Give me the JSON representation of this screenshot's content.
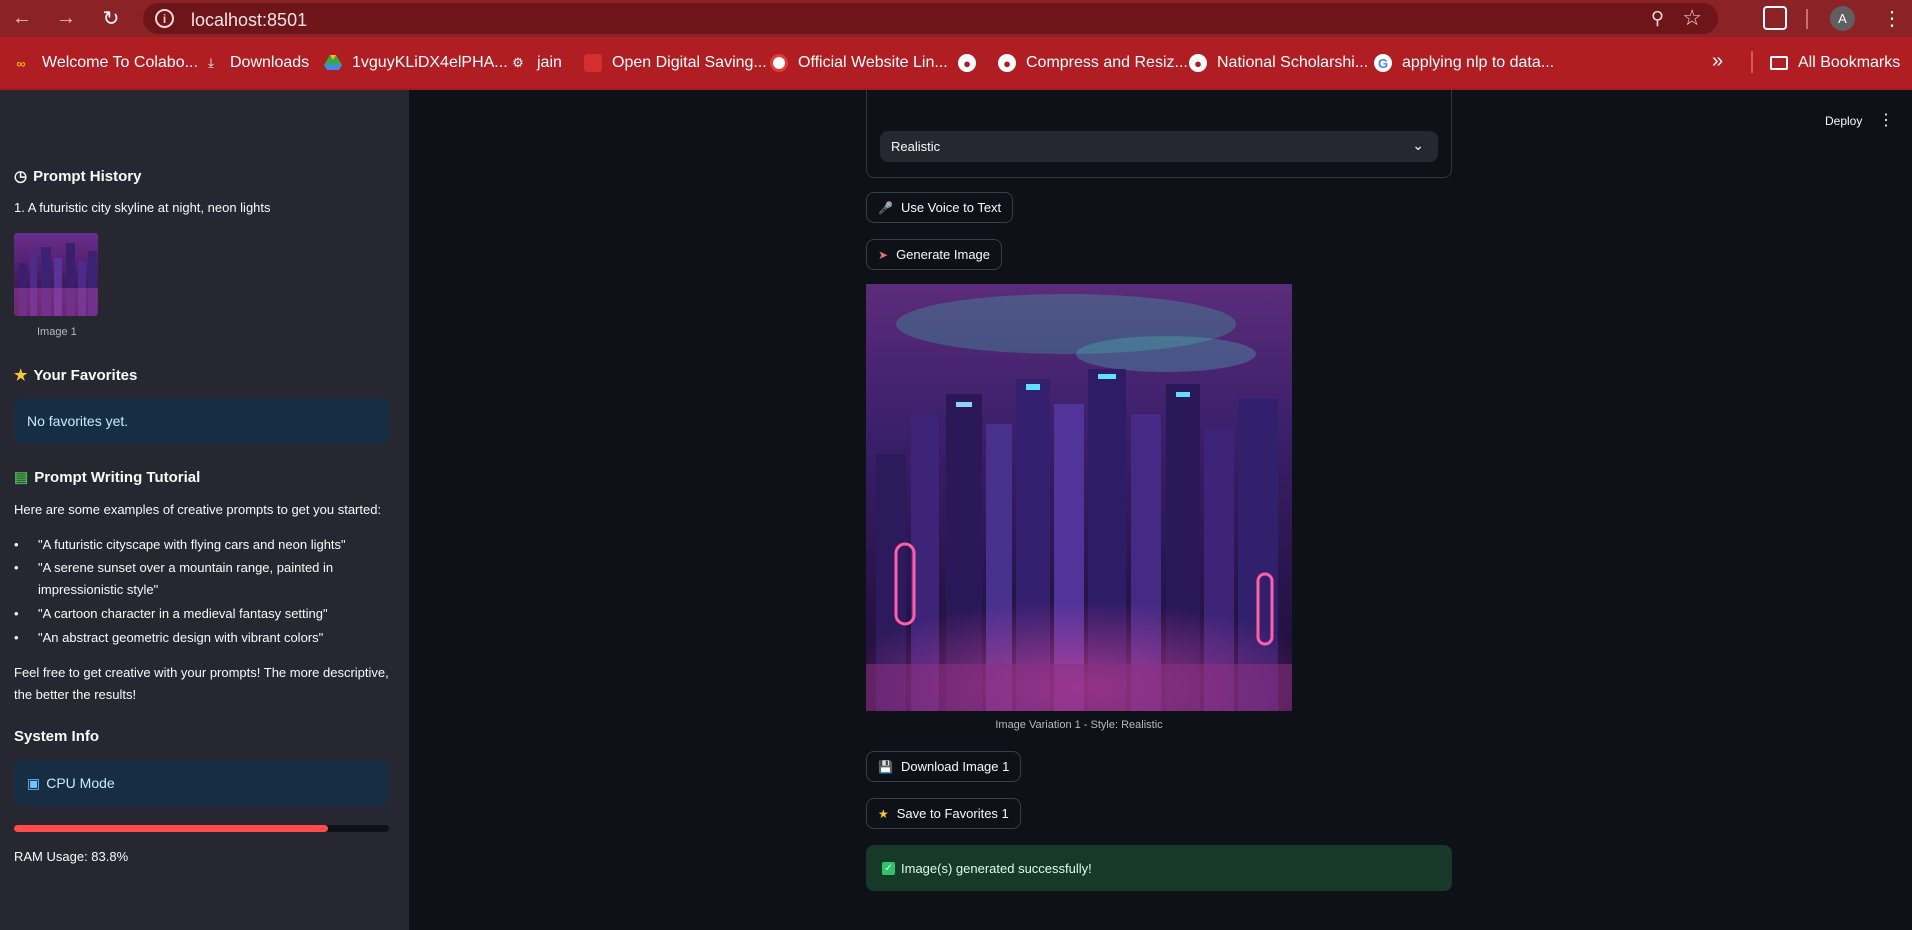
{
  "browser": {
    "url": "localhost:8501",
    "avatar_letter": "A",
    "bookmarks": [
      {
        "label": "Welcome To Colabo...",
        "icon": "colab-icon"
      },
      {
        "label": "Downloads",
        "icon": "download-icon"
      },
      {
        "label": "1vguyKLiDX4elPHA...",
        "icon": "google-drive-icon"
      },
      {
        "label": "jain",
        "icon": "robot-icon"
      },
      {
        "label": "Open Digital Saving...",
        "icon": "bank-icon"
      },
      {
        "label": "Official Website Lin...",
        "icon": "refresh-logo-icon"
      },
      {
        "label": "",
        "icon": "globe-icon"
      },
      {
        "label": "Compress and Resiz...",
        "icon": "globe-icon"
      },
      {
        "label": "National Scholarshi...",
        "icon": "globe-icon"
      },
      {
        "label": "applying nlp to data...",
        "icon": "google-icon"
      },
      {
        "label": "All Bookmarks",
        "icon": "folder-icon"
      }
    ]
  },
  "header": {
    "deploy": "Deploy"
  },
  "sidebar": {
    "history_title": "Prompt History",
    "history_item": "1. A futuristic city skyline at night, neon lights",
    "thumb_caption": "Image 1",
    "favorites_title": "Your Favorites",
    "favorites_empty": "No favorites yet.",
    "tutorial_title": "Prompt Writing Tutorial",
    "tutorial_intro": "Here are some examples of creative prompts to get you started:",
    "tutorial_examples": [
      "\"A futuristic cityscape with flying cars and neon lights\"",
      "\"A serene sunset over a mountain range, painted in",
      "impressionistic style\"",
      "\"A cartoon character in a medieval fantasy setting\"",
      "\"An abstract geometric design with vibrant colors\""
    ],
    "tutorial_outro_1": "Feel free to get creative with your prompts! The more descriptive,",
    "tutorial_outro_2": "the better the results!",
    "system_title": "System Info",
    "cpu_mode": "CPU Mode",
    "ram_usage_label": "RAM Usage: 83.8%",
    "ram_usage_fraction": 0.838
  },
  "main": {
    "style_value": "Realistic",
    "voice_button": "Use Voice to Text",
    "generate_button": "Generate Image",
    "image_caption": "Image Variation 1 - Style: Realistic",
    "download_button": "Download Image 1",
    "favorite_button": "Save to Favorites 1",
    "success_message": "Image(s) generated successfully!"
  },
  "colors": {
    "chrome": "#8b2226",
    "bookmark_bar": "#b01e23",
    "sidebar": "#262730",
    "main_bg": "#0e1117",
    "progress": "#ff4b4b",
    "info_box": "#172d43",
    "success_box": "#173928"
  }
}
